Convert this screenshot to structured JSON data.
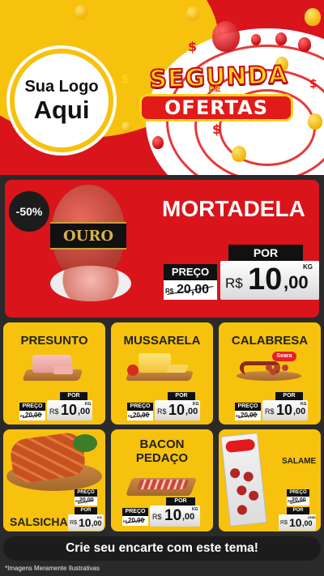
{
  "header": {
    "logo_line1": "Sua Logo",
    "logo_line2": "Aqui",
    "title_top": "SEGUNDA",
    "title_de": "DE",
    "title_bottom": "OFERTAS"
  },
  "featured": {
    "badge": "-50%",
    "name": "MORTADELA",
    "product_label": "OURO",
    "preco_label": "PREÇO",
    "por_label": "POR",
    "old_price": "20,00",
    "old_price_prefix": "R$",
    "currency": "R$",
    "new_int": "10",
    "new_cents": ",00",
    "unit": "KG"
  },
  "products": [
    {
      "name": "PRESUNTO",
      "preco_label": "PREÇO",
      "por_label": "POR",
      "old_prefix": "R$",
      "old_price": "20,00",
      "currency": "R$",
      "new_int": "10",
      "new_cents": ",00",
      "unit": "KG"
    },
    {
      "name": "MUSSARELA",
      "preco_label": "PREÇO",
      "por_label": "POR",
      "old_prefix": "R$",
      "old_price": "20,00",
      "currency": "R$",
      "new_int": "10",
      "new_cents": ",00",
      "unit": "KG"
    },
    {
      "name": "CALABRESA",
      "brand": "Seara",
      "preco_label": "PREÇO",
      "por_label": "POR",
      "old_prefix": "R$",
      "old_price": "20,00",
      "currency": "R$",
      "new_int": "10",
      "new_cents": ",00",
      "unit": "KG"
    },
    {
      "name": "SALSICHA",
      "preco_label": "PREÇO",
      "por_label": "POR",
      "old_prefix": "R$",
      "old_price": "20,00",
      "currency": "R$",
      "new_int": "10",
      "new_cents": ",00",
      "unit": "KG"
    },
    {
      "name_line1": "BACON",
      "name_line2": "PEDAÇO",
      "preco_label": "PREÇO",
      "por_label": "POR",
      "old_prefix": "R$",
      "old_price": "20,00",
      "currency": "R$",
      "new_int": "10",
      "new_cents": ",00",
      "unit": "KG"
    },
    {
      "name": "SALAME",
      "preco_label": "PREÇO",
      "por_label": "POR",
      "old_prefix": "R$",
      "old_price": "20,00",
      "currency": "R$",
      "new_int": "10",
      "new_cents": ",00",
      "unit": "UNID"
    }
  ],
  "cta": "Crie seu encarte com este tema!",
  "footnote": "*Imagens Meramente Ilustrativas",
  "colors": {
    "red": "#d9141b",
    "yellow": "#f6c20d",
    "black": "#1c1c1c",
    "white": "#ffffff"
  }
}
